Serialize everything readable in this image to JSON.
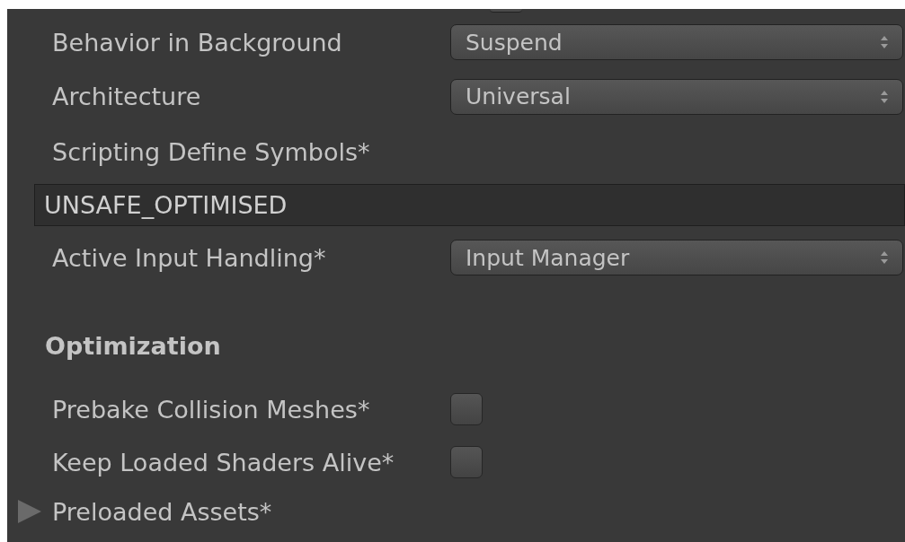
{
  "settings": [
    {
      "kind": "dropdown",
      "label": "Behavior in Background",
      "value": "Suspend"
    },
    {
      "kind": "dropdown",
      "label": "Architecture",
      "value": "Universal"
    },
    {
      "kind": "text_field",
      "label": "Scripting Define Symbols*",
      "value": "UNSAFE_OPTIMISED"
    },
    {
      "kind": "dropdown",
      "label": "Active Input Handling*",
      "value": "Input Manager"
    }
  ],
  "optimization": {
    "title": "Optimization",
    "items": [
      {
        "kind": "checkbox",
        "label": "Prebake Collision Meshes*",
        "checked": false
      },
      {
        "kind": "checkbox",
        "label": "Keep Loaded Shaders Alive*",
        "checked": false
      },
      {
        "kind": "foldout",
        "label": "Preloaded Assets*",
        "expanded": false
      }
    ]
  }
}
